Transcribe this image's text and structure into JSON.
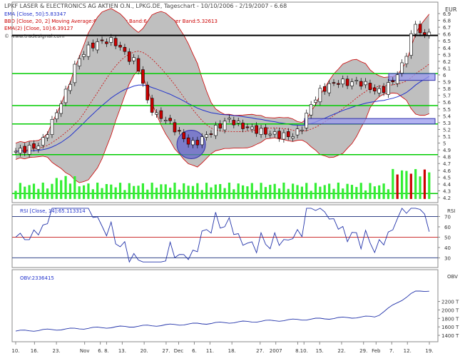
{
  "chart_data": {
    "type": "candlestick",
    "header": {
      "title": "LPKF LASER & ELECTRONICS AG AKTIEN O.N., LPKG.DE, Tageschart - 10/10/2006 - 2/19/2007 - 6.68",
      "legend": [
        "EMA [Close, 50]:5.83347",
        "BBD [Close, 20, 2] Moving Average:6.0895 Upper Band:6.85287 Lower Band:5.32613",
        "EMA(2) [Close, 10]:6.39127"
      ],
      "source": "© www.tradesignal.com",
      "currency": "EUR"
    },
    "y_ticks": [
      "6.9",
      "6.8",
      "6.7",
      "6.6",
      "6.5",
      "6.4",
      "6.3",
      "6.2",
      "6.1",
      "6",
      "5.9",
      "5.8",
      "5.7",
      "5.6",
      "5.5",
      "5.4",
      "5.3",
      "5.2",
      "5.1",
      "5",
      "4.9",
      "4.8",
      "4.7",
      "4.6",
      "4.5",
      "4.4",
      "4.3",
      "4.2"
    ],
    "y_tick_values": [
      6.9,
      6.8,
      6.7,
      6.6,
      6.5,
      6.4,
      6.3,
      6.2,
      6.1,
      6.0,
      5.9,
      5.8,
      5.7,
      5.6,
      5.5,
      5.4,
      5.3,
      5.2,
      5.1,
      5.0,
      4.9,
      4.8,
      4.7,
      4.6,
      4.5,
      4.4,
      4.3,
      4.2
    ],
    "horizontal_lines": [
      {
        "value": 6.58,
        "color": "#000000"
      },
      {
        "value": 6.02,
        "color": "#00cc00"
      },
      {
        "value": 5.55,
        "color": "#00cc00"
      },
      {
        "value": 5.28,
        "color": "#00cc00"
      },
      {
        "value": 4.83,
        "color": "#00cc00"
      },
      {
        "value": 4.26,
        "color": "#00cc00"
      }
    ],
    "x_labels": [
      "10.",
      "16.",
      "23.",
      "Nov",
      "6.",
      "8.",
      "13.",
      "20.",
      "27.",
      "Dec",
      "6.",
      "11.",
      "18.",
      "27.",
      "2007",
      "8.",
      "10.",
      "15.",
      "22.",
      "29.",
      "Feb",
      "7.",
      "12.",
      "19."
    ],
    "x_label_days": [
      0,
      6,
      13,
      22,
      27,
      29,
      34,
      41,
      48,
      52,
      57,
      62,
      69,
      78,
      83,
      90,
      92,
      97,
      104,
      111,
      115,
      120,
      125,
      132
    ],
    "colors": {
      "up": "#ffffff",
      "down": "#cc0000",
      "ema50": "#2233cc",
      "band": "#bfbfbf",
      "band_edge": "#cc0000",
      "volume": "#33ee33",
      "rsi": "#2233aa",
      "obv": "#2233aa"
    },
    "rsi": {
      "label": "RSI [Close, 14]:65.113314",
      "title": "RSI",
      "ticks": [
        "70",
        "60",
        "50",
        "40",
        "30"
      ],
      "tick_values": [
        70,
        60,
        50,
        40,
        30
      ],
      "levels": [
        70,
        50,
        30
      ],
      "ylim": [
        22,
        80
      ]
    },
    "obv": {
      "label": "OBV:2336415",
      "title": "OBV",
      "ticks": [
        "2200 T",
        "2000 T",
        "1800 T",
        "1600 T",
        "1400 T"
      ],
      "tick_values": [
        2200,
        2000,
        1800,
        1600,
        1400
      ],
      "ylim": [
        1300,
        2900
      ]
    }
  }
}
